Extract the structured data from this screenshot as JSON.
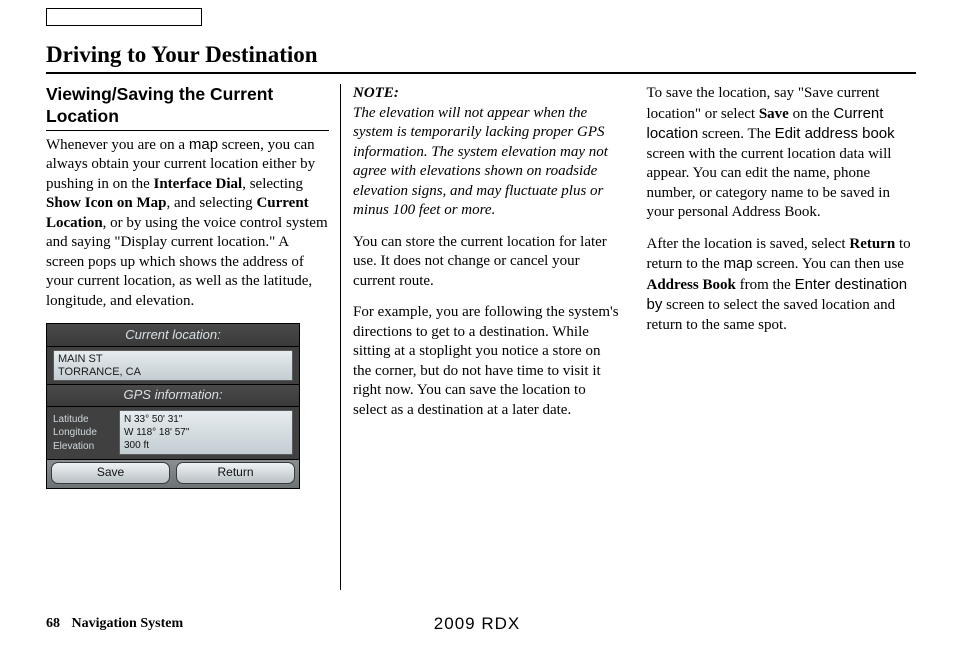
{
  "header": {
    "title": "Driving to Your Destination"
  },
  "section": {
    "title": "Viewing/Saving the Current Location"
  },
  "col1": {
    "p1a": "Whenever you are on a ",
    "p1_map": "map",
    "p1b": " screen, you can always obtain your current location either by pushing in on the ",
    "p1_iface": "Interface Dial",
    "p1c": ", selecting ",
    "p1_show": "Show Icon on Map",
    "p1d": ", and selecting ",
    "p1_cur": "Current Location",
    "p1e": ", or by using the voice control system and saying \"Display current location.\" A screen pops up which shows the address of your current location, as well as the latitude, longitude, and elevation."
  },
  "nav": {
    "title": "Current location:",
    "addr1": "MAIN ST",
    "addr2": "TORRANCE, CA",
    "gps_title": "GPS information:",
    "l_lat": "Latitude",
    "l_lon": "Longitude",
    "l_elev": "Elevation",
    "v_lat": "N 33° 50' 31\"",
    "v_lon": "W 118° 18' 57\"",
    "v_elev": "300 ft",
    "btn_save": "Save",
    "btn_return": "Return"
  },
  "col2": {
    "note_label": "NOTE:",
    "note": "The elevation will not appear when the system is temporarily lacking proper GPS information. The system elevation may not agree with elevations shown on roadside elevation signs, and may fluctuate plus or minus 100 feet or more.",
    "p2": "You can store the current location for later use. It does not change or cancel your current route.",
    "p3": "For example, you are following the system's directions to get to a destination. While sitting at a stoplight you notice a store on the corner, but do not have time to visit it right now. You can save the location to select as a destination at a later date."
  },
  "col3": {
    "p1a": "To save the location, say \"Save current location\" or select ",
    "p1_save": "Save",
    "p1b": " on the ",
    "p1_cur": "Current location",
    "p1c": " screen. The ",
    "p1_edit": "Edit address book",
    "p1d": " screen with the current location data will appear. You can edit the name, phone number, or category name to be saved in your personal Address Book.",
    "p2a": "After the location is saved, select ",
    "p2_return": "Return",
    "p2b": " to return to the ",
    "p2_map": "map",
    "p2c": " screen. You can then use ",
    "p2_ab": "Address Book",
    "p2d": " from the ",
    "p2_enter": "Enter destination by",
    "p2e": " screen to select the saved location and return to the same spot."
  },
  "footer": {
    "page": "68",
    "section": "Navigation System"
  },
  "model": "2009  RDX"
}
